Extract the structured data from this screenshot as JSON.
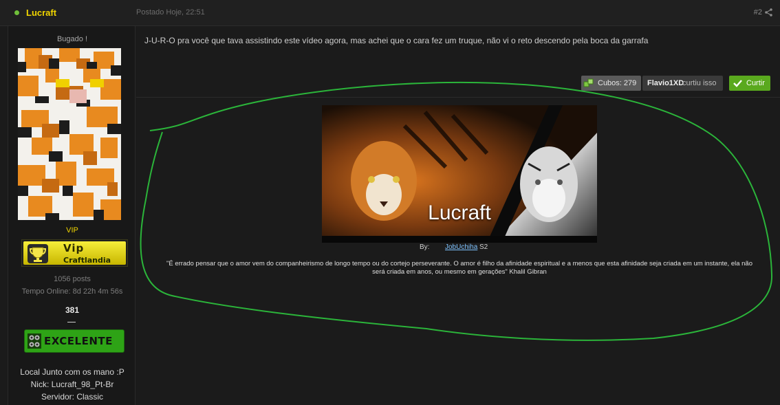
{
  "post": {
    "author": "Lucraft",
    "posted": "Postado Hoje, 22:51",
    "number": "#2"
  },
  "profile": {
    "title": "Bugado !",
    "rank": "VIP",
    "vip_badge": {
      "line1": "Vip",
      "line2": "Craftlandia"
    },
    "posts": "1056 posts",
    "online_time": "Tempo Online: 8d 22h 4m 56s",
    "reputation": "381",
    "reputation_badge": "EXCELENTE",
    "location": "Local Junto com os mano :P",
    "nick": "Nick: Lucraft_98_Pt-Br",
    "server": "Servidor: Classic"
  },
  "message": "J-U-R-O pra você que tava assistindo este vídeo agora, mas achei que o cara fez um truque, não vi o reto descendo pela boca da garrafa",
  "actions": {
    "cubos": "Cubos: 279",
    "liker": "Flavio1XD",
    "liked_text": "curtiu isso",
    "like_button": "Curtir"
  },
  "signature": {
    "banner_title": "Lucraft",
    "credit_by": "By:",
    "credit_link": "JobUchiha",
    "credit_suffix": "S2",
    "quote_line1": "\"É errado pensar que o amor vem do companheirismo de longo tempo ou do cortejo perseverante. O amor é filho da afinidade espiritual e a menos que esta afinidade seja criada em um instante, ela não",
    "quote_line2": "será criada em anos, ou mesmo em gerações\" Khalil Gibran"
  },
  "colors": {
    "author": "#f2d600",
    "online": "#6fbf3a",
    "like_button": "#5aa91e",
    "annotation": "#2bb53a"
  },
  "icons": [
    "share-icon",
    "trophy-icon",
    "cube-icon",
    "check-icon",
    "excelente-icon"
  ]
}
